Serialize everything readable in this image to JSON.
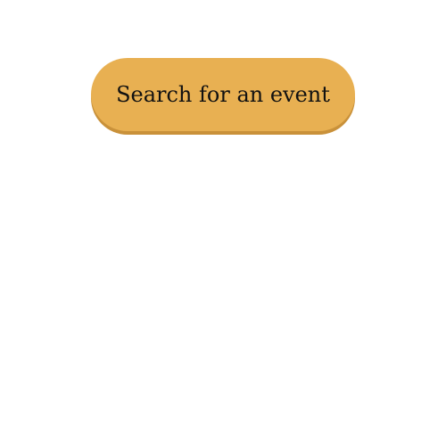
{
  "search_button": {
    "label": "Search for an event",
    "background_color": "#e8b052",
    "text_color": "#111111"
  }
}
